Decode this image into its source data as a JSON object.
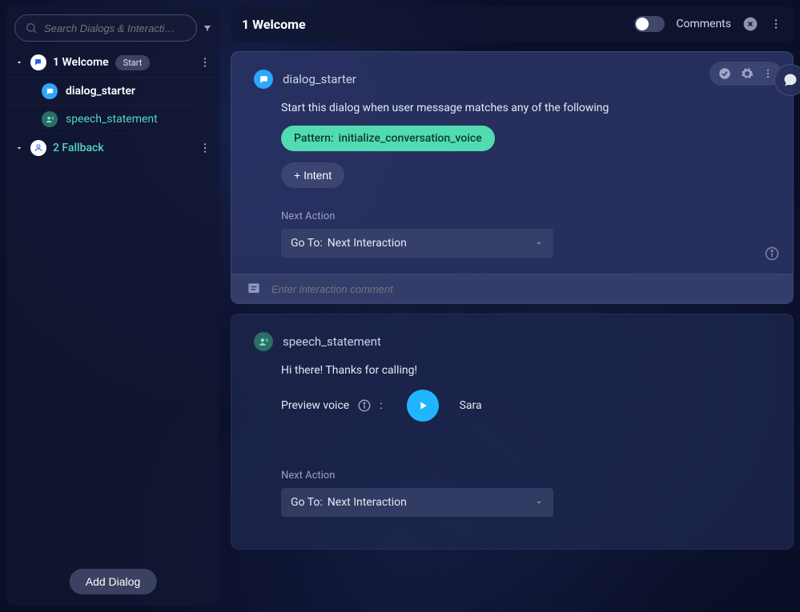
{
  "sidebar": {
    "search_placeholder": "Search Dialogs & Interacti…",
    "dialogs": [
      {
        "title": "1 Welcome",
        "badge": "Start",
        "expanded": true,
        "interactions": [
          {
            "label": "dialog_starter",
            "type": "starter"
          },
          {
            "label": "speech_statement",
            "type": "speech"
          }
        ]
      },
      {
        "title": "2 Fallback",
        "expanded": false
      }
    ],
    "add_dialog_label": "Add Dialog"
  },
  "header": {
    "title": "1 Welcome",
    "comments_label": "Comments"
  },
  "cards": {
    "starter": {
      "title": "dialog_starter",
      "description": "Start this dialog when user message matches any of the following",
      "pattern_label": "Pattern:",
      "pattern_value": "initialize_conversation_voice",
      "intent_btn": "+ Intent",
      "next_action_label": "Next Action",
      "goto_label": "Go To:",
      "goto_value": "Next Interaction",
      "comment_placeholder": "Enter interaction comment"
    },
    "speech": {
      "title": "speech_statement",
      "message": "Hi there! Thanks for calling!",
      "preview_label": "Preview voice",
      "voice_name": "Sara",
      "next_action_label": "Next Action",
      "goto_label": "Go To:",
      "goto_value": "Next Interaction"
    }
  }
}
